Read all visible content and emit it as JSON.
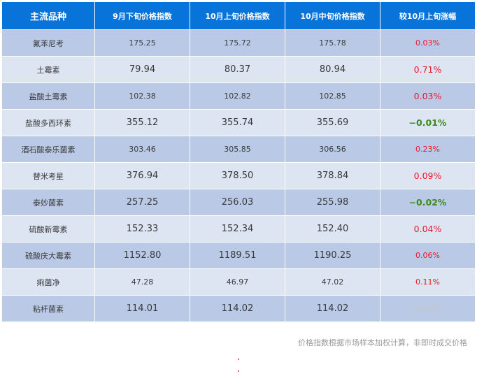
{
  "table": {
    "headers": [
      "主流品种",
      "9月下旬价格指数",
      "10月上旬价格指数",
      "10月中旬价格指数",
      "较10月上旬涨幅"
    ],
    "rows": [
      {
        "name": "氟苯尼考",
        "sep": "175.25",
        "oct_early": "175.72",
        "oct_mid": "175.78",
        "change": "0.03%",
        "trend": "up",
        "big_text": false,
        "big_change": false
      },
      {
        "name": "土霉素",
        "sep": "79.94",
        "oct_early": "80.37",
        "oct_mid": "80.94",
        "change": "0.71%",
        "trend": "up",
        "big_text": true,
        "big_change": true
      },
      {
        "name": "盐酸土霉素",
        "sep": "102.38",
        "oct_early": "102.82",
        "oct_mid": "102.85",
        "change": "0.03%",
        "trend": "up",
        "big_text": false,
        "big_change": true
      },
      {
        "name": "盐酸多西环素",
        "sep": "355.12",
        "oct_early": "355.74",
        "oct_mid": "355.69",
        "change": "−0.01%",
        "trend": "down",
        "big_text": true,
        "big_change": true
      },
      {
        "name": "酒石酸泰乐菌素",
        "sep": "303.46",
        "oct_early": "305.85",
        "oct_mid": "306.56",
        "change": "0.23%",
        "trend": "up",
        "big_text": false,
        "big_change": false
      },
      {
        "name": "替米考星",
        "sep": "376.94",
        "oct_early": "378.50",
        "oct_mid": "378.84",
        "change": "0.09%",
        "trend": "up",
        "big_text": true,
        "big_change": true
      },
      {
        "name": "泰妙菌素",
        "sep": "257.25",
        "oct_early": "256.03",
        "oct_mid": "255.98",
        "change": "−0.02%",
        "trend": "down",
        "big_text": true,
        "big_change": true
      },
      {
        "name": "硫酸新霉素",
        "sep": "152.33",
        "oct_early": "152.34",
        "oct_mid": "152.40",
        "change": "0.04%",
        "trend": "up",
        "big_text": true,
        "big_change": true
      },
      {
        "name": "硫酸庆大霉素",
        "sep": "1152.80",
        "oct_early": "1189.51",
        "oct_mid": "1190.25",
        "change": "0.06%",
        "trend": "up",
        "big_text": true,
        "big_change": false
      },
      {
        "name": "痢菌净",
        "sep": "47.28",
        "oct_early": "46.97",
        "oct_mid": "47.02",
        "change": "0.11%",
        "trend": "up",
        "big_text": false,
        "big_change": false
      },
      {
        "name": "粘杆菌素",
        "sep": "114.01",
        "oct_early": "114.02",
        "oct_mid": "114.02",
        "change": "0.00%",
        "trend": "flat",
        "big_text": true,
        "big_change": true
      }
    ]
  },
  "note": "价格指数根据市场样本加权计算，非即时成交价格",
  "colors": {
    "header_bg": "#0873d8",
    "row_dark": "#b9c9e6",
    "row_light": "#dde5f3",
    "up": "#e8192c",
    "down": "#3c8a1f",
    "flat": "#c6c6c6"
  }
}
